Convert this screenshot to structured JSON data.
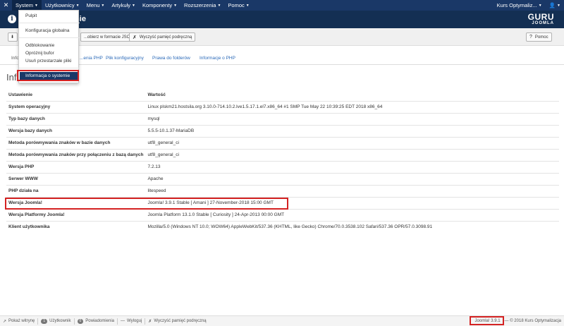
{
  "navbar": {
    "items": [
      {
        "label": "System"
      },
      {
        "label": "Użytkownicy"
      },
      {
        "label": "Menu"
      },
      {
        "label": "Artykuły"
      },
      {
        "label": "Komponenty"
      },
      {
        "label": "Rozszerzenia"
      },
      {
        "label": "Pomoc"
      }
    ],
    "site_name": "Kurs Optymaliz...",
    "user_icon": "user-icon"
  },
  "header": {
    "title_partial": "mie",
    "logo_line1": "GURU",
    "logo_line2": "JOOMLA"
  },
  "toolbar": {
    "download_label": "...obierz w formacie JSON",
    "clear_cache_label": "Wyczyść pamięć podręczną",
    "help_label": "Pomoc"
  },
  "tabs": [
    {
      "label": "Info"
    },
    {
      "label": "...enia PHP"
    },
    {
      "label": "Plik konfiguracyjny"
    },
    {
      "label": "Prawa do folderów"
    },
    {
      "label": "Informacje o PHP"
    }
  ],
  "section_title": "Info",
  "table": {
    "headers": [
      "Ustawienie",
      "Wartość"
    ],
    "rows": [
      {
        "k": "System operacyjny",
        "v": "Linux plskm21.hostsila.org 3.10.0-714.10.2.lve1.5.17.1.el7.x86_64 #1 SMP Tue May 22 10:39:25 EDT 2018 x86_64"
      },
      {
        "k": "Typ bazy danych",
        "v": "mysql"
      },
      {
        "k": "Wersja bazy danych",
        "v": "5.5.5-10.1.37-MariaDB"
      },
      {
        "k": "Metoda porównywania znaków w bazie danych",
        "v": "utf8_general_ci"
      },
      {
        "k": "Metoda porównywania znaków przy połączeniu z bazą danych",
        "v": "utf8_general_ci"
      },
      {
        "k": "Wersja PHP",
        "v": "7.2.13"
      },
      {
        "k": "Serwer WWW",
        "v": "Apache"
      },
      {
        "k": "PHP działa na",
        "v": "litespeed"
      },
      {
        "k": "Wersja Joomla!",
        "v": "Joomla! 3.9.1 Stable [ Amani ] 27-November-2018 15:00 GMT"
      },
      {
        "k": "Wersja Platformy Joomla!",
        "v": "Joomla Platform 13.1.0 Stable [ Curiosity ] 24-Apr-2013 00:00 GMT"
      },
      {
        "k": "Klient użytkownika",
        "v": "Mozilla/5.0 (Windows NT 10.0; WOW64) AppleWebKit/537.36 (KHTML, like Gecko) Chrome/70.0.3538.102 Safari/537.36 OPR/57.0.3098.91"
      }
    ]
  },
  "dropdown": {
    "items": [
      "Pulpit",
      "Konfiguracja globalna",
      "Odblokowanie",
      "Opróżnij bufor",
      "Usuń przestarzałe pliki"
    ],
    "active": "Informacja o systemie"
  },
  "statusbar": {
    "view_site": "Pokaż witrynę",
    "users_count": "1",
    "users_label": "Użytkownik",
    "notif_count": "0",
    "notif_label": "Powiadomienia",
    "logout": "Wyloguj",
    "clear_cache": "Wyczyść pamięć podręczną",
    "version": "Joomla! 3.9.1",
    "copyright": "— © 2018 Kurs Optymalizacja"
  },
  "colors": {
    "navbar": "#1a3867",
    "header": "#132f53",
    "highlight": "#d42222",
    "link": "#2a69b8"
  }
}
